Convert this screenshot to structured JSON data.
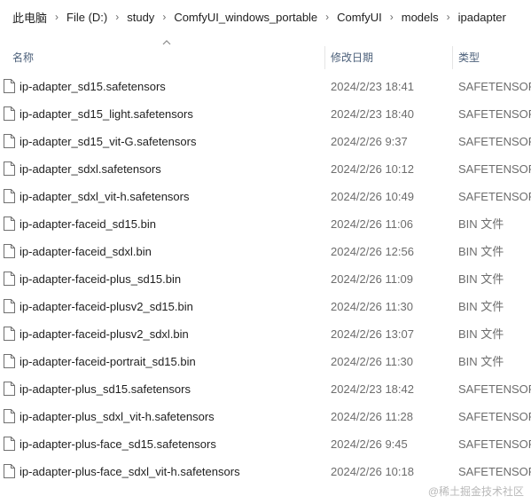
{
  "breadcrumb": [
    "此电脑",
    "File (D:)",
    "study",
    "ComfyUI_windows_portable",
    "ComfyUI",
    "models",
    "ipadapter"
  ],
  "columns": {
    "name": "名称",
    "date": "修改日期",
    "type": "类型"
  },
  "files": [
    {
      "name": "ip-adapter_sd15.safetensors",
      "date": "2024/2/23 18:41",
      "type": "SAFETENSORS"
    },
    {
      "name": "ip-adapter_sd15_light.safetensors",
      "date": "2024/2/23 18:40",
      "type": "SAFETENSORS"
    },
    {
      "name": "ip-adapter_sd15_vit-G.safetensors",
      "date": "2024/2/26 9:37",
      "type": "SAFETENSORS"
    },
    {
      "name": "ip-adapter_sdxl.safetensors",
      "date": "2024/2/26 10:12",
      "type": "SAFETENSORS"
    },
    {
      "name": "ip-adapter_sdxl_vit-h.safetensors",
      "date": "2024/2/26 10:49",
      "type": "SAFETENSORS"
    },
    {
      "name": "ip-adapter-faceid_sd15.bin",
      "date": "2024/2/26 11:06",
      "type": "BIN 文件"
    },
    {
      "name": "ip-adapter-faceid_sdxl.bin",
      "date": "2024/2/26 12:56",
      "type": "BIN 文件"
    },
    {
      "name": "ip-adapter-faceid-plus_sd15.bin",
      "date": "2024/2/26 11:09",
      "type": "BIN 文件"
    },
    {
      "name": "ip-adapter-faceid-plusv2_sd15.bin",
      "date": "2024/2/26 11:30",
      "type": "BIN 文件"
    },
    {
      "name": "ip-adapter-faceid-plusv2_sdxl.bin",
      "date": "2024/2/26 13:07",
      "type": "BIN 文件"
    },
    {
      "name": "ip-adapter-faceid-portrait_sd15.bin",
      "date": "2024/2/26 11:30",
      "type": "BIN 文件"
    },
    {
      "name": "ip-adapter-plus_sd15.safetensors",
      "date": "2024/2/23 18:42",
      "type": "SAFETENSORS"
    },
    {
      "name": "ip-adapter-plus_sdxl_vit-h.safetensors",
      "date": "2024/2/26 11:28",
      "type": "SAFETENSORS"
    },
    {
      "name": "ip-adapter-plus-face_sd15.safetensors",
      "date": "2024/2/26 9:45",
      "type": "SAFETENSORS"
    },
    {
      "name": "ip-adapter-plus-face_sdxl_vit-h.safetensors",
      "date": "2024/2/26 10:18",
      "type": "SAFETENSORS"
    }
  ],
  "watermark": "@稀土掘金技术社区",
  "icons": {
    "file": "file-icon",
    "separator": "chevron-right-icon",
    "sort": "sort-up-icon"
  }
}
